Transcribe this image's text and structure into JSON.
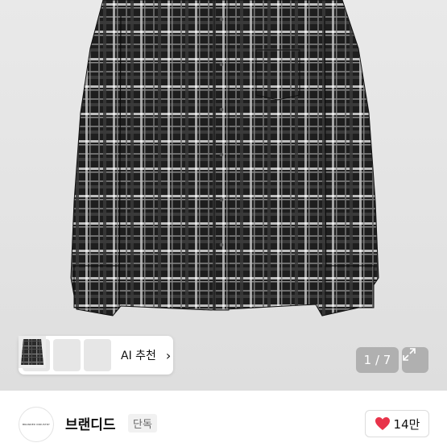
{
  "product": {
    "image_alt": "black and white plaid flannel shirt",
    "recommend": {
      "label": "AI 추천",
      "chevron": "chevron-right-icon"
    },
    "pager": "1 / 7",
    "expand_icon": "expand-icon"
  },
  "seller": {
    "avatar_text": "BRANDED INDUSTRY",
    "name": "브랜디드",
    "badge": "단독"
  },
  "like": {
    "icon": "heart-icon",
    "count": "14만",
    "color": "#e8334a"
  },
  "colors": {
    "background": "#e4e4e4",
    "fabric_dark": "#1d1d1d",
    "fabric_light": "#d9d9d9"
  }
}
